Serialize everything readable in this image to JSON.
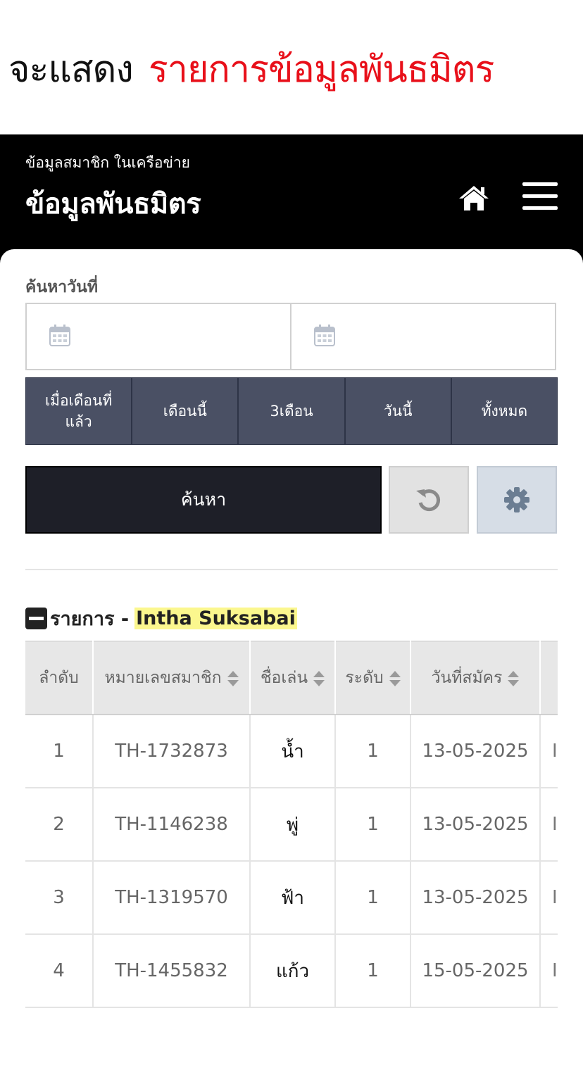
{
  "caption": {
    "prefix": "จะแสดง",
    "highlight": "รายการข้อมูลพันธมิตร",
    "highlight_color": "#e8101a"
  },
  "header": {
    "subtitle": "ข้อมูลสมาชิก ในเครือข่าย",
    "title": "ข้อมูลพันธมิตร",
    "icons": [
      "home-icon",
      "hamburger-menu-icon"
    ]
  },
  "search": {
    "label": "ค้นหาวันที่",
    "date_from": {
      "value": "",
      "icon": "calendar-icon"
    },
    "date_to": {
      "value": "",
      "icon": "calendar-icon"
    },
    "quick_filters": [
      "เมื่อเดือนที่แล้ว",
      "เดือนนี้",
      "3เดือน",
      "วันนี้",
      "ทั้งหมด"
    ],
    "search_button": "ค้นหา",
    "reset_icon": "reset-icon",
    "settings_icon": "gear-icon"
  },
  "list": {
    "title": "รายการ - ",
    "owner": "Intha Suksabai",
    "columns": [
      "ลำดับ",
      "หมายเลขสมาชิก",
      "ชื่อเล่น",
      "ระดับ",
      "วันที่สมัคร",
      ""
    ],
    "rows": [
      {
        "no": "1",
        "member_id": "TH-1732873",
        "nickname": "น้ำ",
        "level": "1",
        "joined": "13-05-2025",
        "extra": "In"
      },
      {
        "no": "2",
        "member_id": "TH-1146238",
        "nickname": "พู่",
        "level": "1",
        "joined": "13-05-2025",
        "extra": "In"
      },
      {
        "no": "3",
        "member_id": "TH-1319570",
        "nickname": "ฟ้า",
        "level": "1",
        "joined": "13-05-2025",
        "extra": "In"
      },
      {
        "no": "4",
        "member_id": "TH-1455832",
        "nickname": "แก้ว",
        "level": "1",
        "joined": "15-05-2025",
        "extra": "In"
      }
    ]
  },
  "colors": {
    "header_bg": "#000000",
    "quick_btn_bg": "#4a5064",
    "search_btn_bg": "#1e1f28",
    "highlight_bg": "#fbf78e"
  }
}
